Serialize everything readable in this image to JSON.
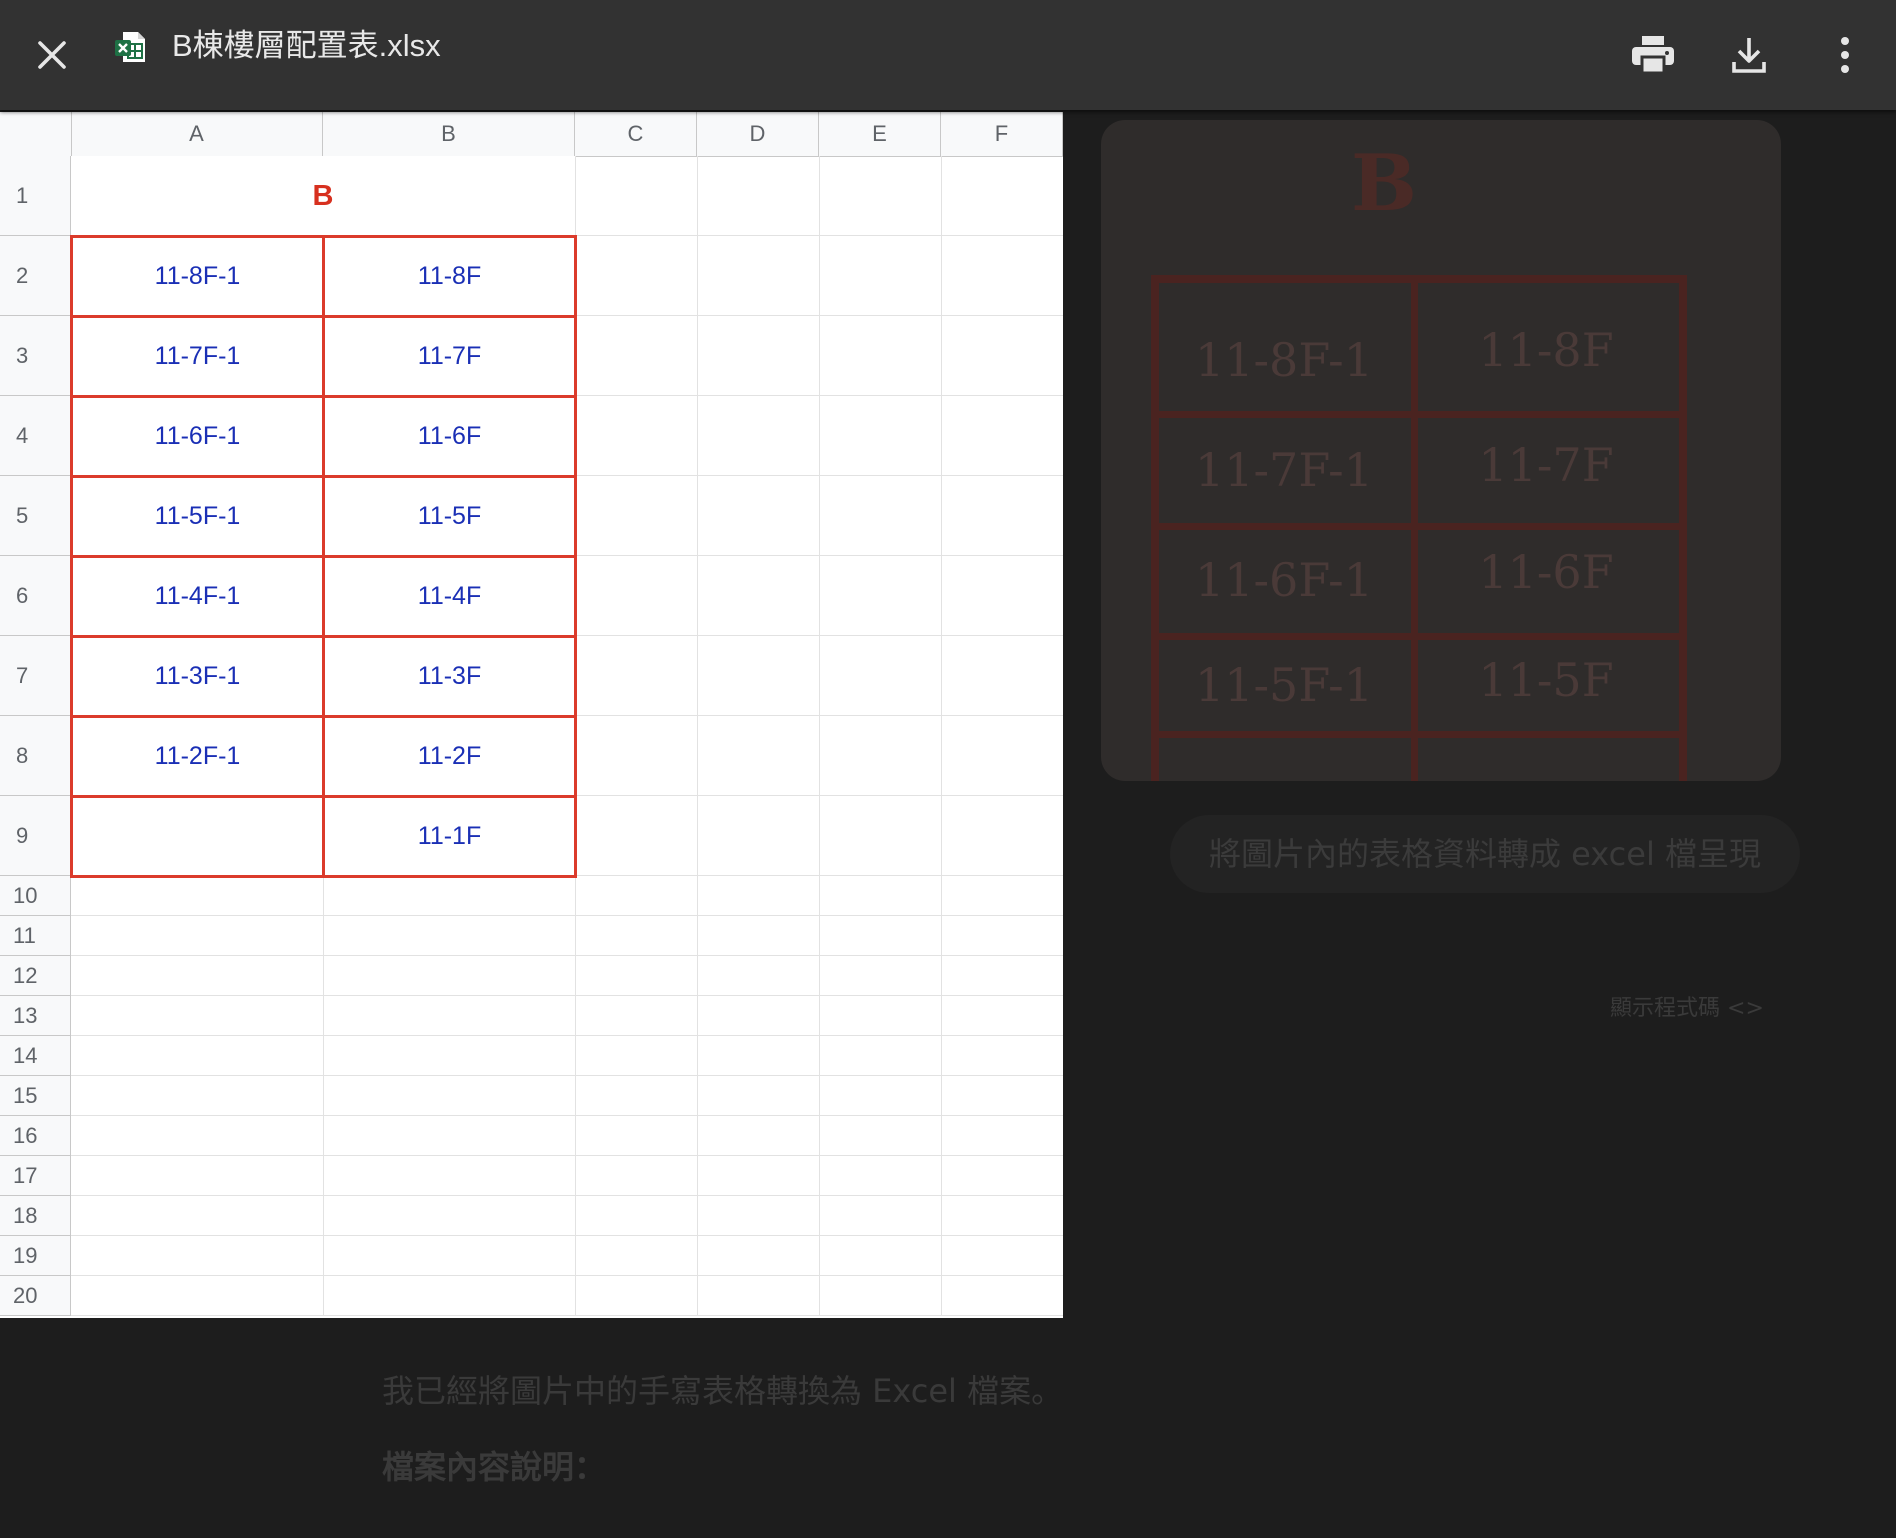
{
  "toolbar": {
    "file_name": "B棟樓層配置表.xlsx",
    "close_icon": "close-icon",
    "file_icon": "excel-file-icon",
    "print_icon": "print-icon",
    "download_icon": "download-icon",
    "more_icon": "more-vertical-icon"
  },
  "sheet": {
    "columns": [
      "A",
      "B",
      "C",
      "D",
      "E",
      "F"
    ],
    "rows": [
      "1",
      "2",
      "3",
      "4",
      "5",
      "6",
      "7",
      "8",
      "9",
      "10",
      "11",
      "12",
      "13",
      "14",
      "15",
      "16",
      "17",
      "18",
      "19",
      "20"
    ],
    "title_cell": "B",
    "table": [
      [
        "11-8F-1",
        "11-8F"
      ],
      [
        "11-7F-1",
        "11-7F"
      ],
      [
        "11-6F-1",
        "11-6F"
      ],
      [
        "11-5F-1",
        "11-5F"
      ],
      [
        "11-4F-1",
        "11-4F"
      ],
      [
        "11-3F-1",
        "11-3F"
      ],
      [
        "11-2F-1",
        "11-2F"
      ],
      [
        "",
        "11-1F"
      ]
    ],
    "colors": {
      "border": "#db3b2b",
      "title": "#d7301f",
      "text": "#1a2fb5"
    }
  },
  "background": {
    "handwritten": {
      "title": "B",
      "cells": [
        [
          "11-8F-1",
          "11-8F"
        ],
        [
          "11-7F-1",
          "11-7F"
        ],
        [
          "11-6F-1",
          "11-6F"
        ],
        [
          "11-5F-1",
          "11-5F"
        ]
      ]
    },
    "user_prompt": "將圖片內的表格資料轉成 excel 檔呈現",
    "show_code": "顯示程式碼",
    "reply_line1": "我已經將圖片中的手寫表格轉換為 Excel 檔案。",
    "reply_line2": "檔案內容說明："
  }
}
